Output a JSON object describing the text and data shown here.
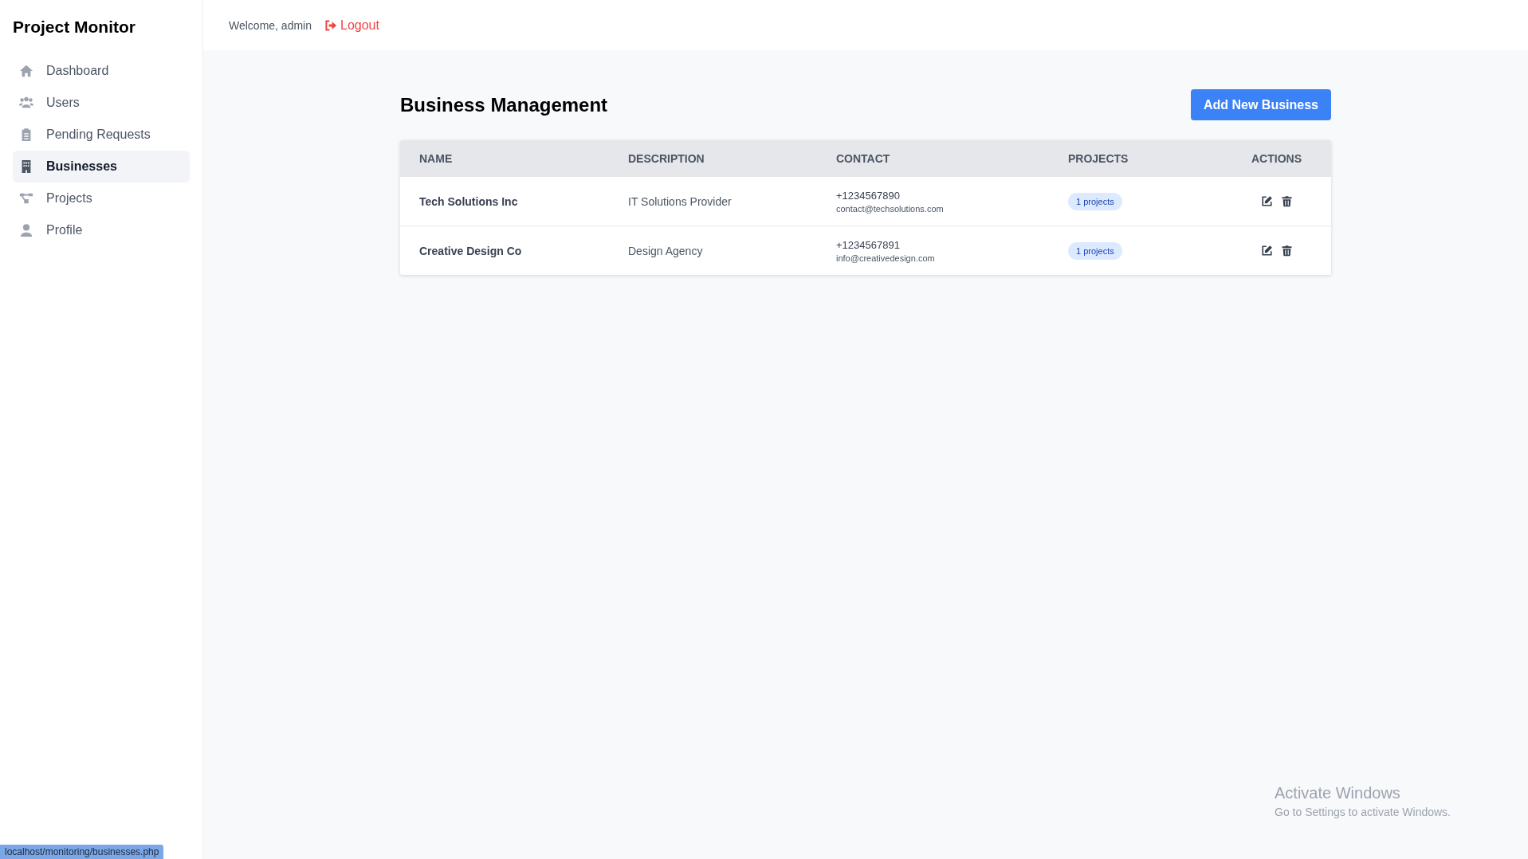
{
  "sidebar": {
    "title": "Project Monitor",
    "items": [
      {
        "label": "Dashboard",
        "selected": false
      },
      {
        "label": "Users",
        "selected": false
      },
      {
        "label": "Pending Requests",
        "selected": false
      },
      {
        "label": "Businesses",
        "selected": true
      },
      {
        "label": "Projects",
        "selected": false
      },
      {
        "label": "Profile",
        "selected": false
      }
    ]
  },
  "header": {
    "welcome": "Welcome, admin",
    "logout": "Logout"
  },
  "page": {
    "title": "Business Management",
    "add_button": "Add New Business"
  },
  "table": {
    "columns": [
      "NAME",
      "DESCRIPTION",
      "CONTACT",
      "PROJECTS",
      "ACTIONS"
    ],
    "rows": [
      {
        "name": "Tech Solutions Inc",
        "description": "IT Solutions Provider",
        "phone": "+1234567890",
        "email": "contact@techsolutions.com",
        "projects": "1 projects"
      },
      {
        "name": "Creative Design Co",
        "description": "Design Agency",
        "phone": "+1234567891",
        "email": "info@creativedesign.com",
        "projects": "1 projects"
      }
    ]
  },
  "os_notice": {
    "title": "Activate Windows",
    "subtitle": "Go to Settings to activate Windows."
  },
  "status_bar": {
    "url": "localhost/monitoring/businesses.php"
  }
}
